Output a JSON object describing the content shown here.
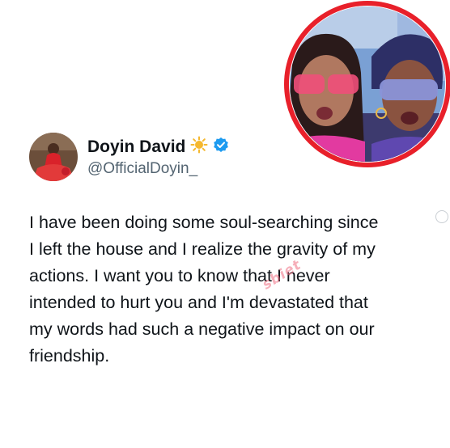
{
  "tweet": {
    "author_name": "Doyin David",
    "handle": "@OfficialDoyin_",
    "body": "I have been doing some soul-searching since\nI left the house and I realize the gravity of my\nactions. I want you to know that I never\nintended to hurt you and I'm devastated that\nmy words had such a negative impact on our\nfriendship.",
    "name_emoji_icon": "sun-icon",
    "verified_icon": "verified-badge-icon"
  },
  "watermark": {
    "text": "sbiet"
  },
  "colors": {
    "verified": "#1d9bf0",
    "sun": "#f5b82e",
    "photo_border": "#e8202a",
    "handle": "#536471",
    "avatar_outfit": "#d9222a"
  }
}
